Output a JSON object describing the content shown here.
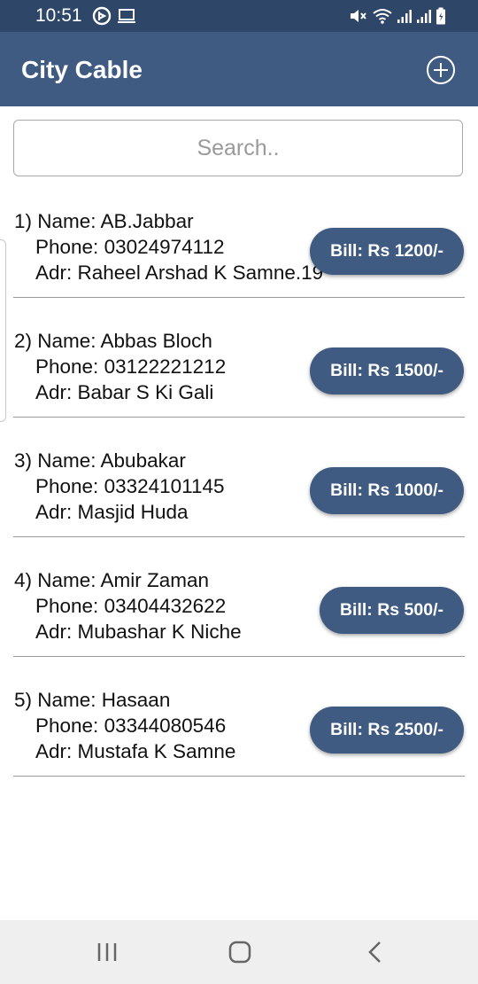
{
  "status_bar": {
    "time": "10:51",
    "left_icons": [
      "bixby-icon",
      "cast-icon"
    ],
    "right_icons": [
      "mute-icon",
      "wifi-icon",
      "signal-icon",
      "signal-icon",
      "battery-icon"
    ]
  },
  "app_bar": {
    "title": "City Cable",
    "add_icon": "plus-circle-icon"
  },
  "search": {
    "placeholder": "Search..",
    "value": ""
  },
  "customers": [
    {
      "name_line": "1) Name: AB.Jabbar",
      "phone_line": "Phone: 03024974112",
      "address_line": "Adr: Raheel Arshad K Samne.19",
      "bill_label": "Bill: Rs 1200/-"
    },
    {
      "name_line": "2) Name: Abbas Bloch",
      "phone_line": "Phone: 03122221212",
      "address_line": "Adr: Babar S Ki Gali",
      "bill_label": "Bill: Rs 1500/-"
    },
    {
      "name_line": "3) Name: Abubakar",
      "phone_line": "Phone: 03324101145",
      "address_line": "Adr: Masjid Huda",
      "bill_label": "Bill: Rs 1000/-"
    },
    {
      "name_line": "4) Name: Amir Zaman",
      "phone_line": "Phone: 03404432622",
      "address_line": "Adr: Mubashar K Niche",
      "bill_label": "Bill: Rs 500/-"
    },
    {
      "name_line": "5) Name: Hasaan",
      "phone_line": "Phone: 03344080546",
      "address_line": "Adr: Mustafa K Samne",
      "bill_label": "Bill: Rs 2500/-"
    }
  ],
  "nav_bar": {
    "recents_icon": "recents-icon",
    "home_icon": "home-icon",
    "back_icon": "back-icon"
  },
  "colors": {
    "status_bar": "#2e4667",
    "app_bar": "#3f5b82",
    "bill_button": "#3f5b82",
    "divider": "#9a9a9a",
    "nav_bar": "#efefef"
  }
}
